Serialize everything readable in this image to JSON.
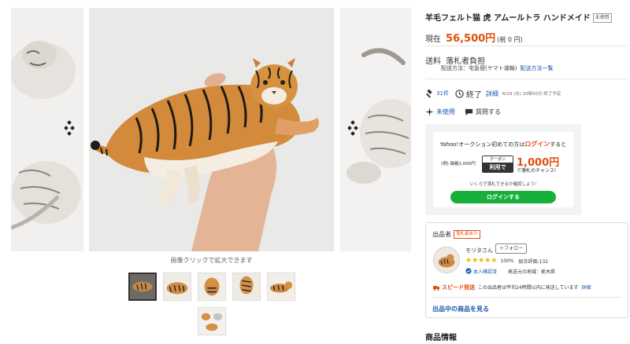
{
  "product": {
    "title": "羊毛フェルト猫 虎 アムールトラ ハンドメイド",
    "condition_badge": "未使用"
  },
  "gallery": {
    "zoom_caption": "画像クリックで拡大できます",
    "thumbnail_count": 6,
    "active_thumbnail": 1
  },
  "price": {
    "label": "現在",
    "value": "56,500円",
    "tax": "(税 0 円)"
  },
  "shipping": {
    "label": "送料",
    "value": "落札者負担",
    "method": "配送方法：宅急便(ヤマト運輸)",
    "method_link": "配送方法一覧"
  },
  "auction": {
    "bid_count": "31件",
    "end_label": "終了",
    "detail_link": "詳細",
    "end_date": "6/19 (水) 20時50分 終了予定"
  },
  "item_meta": {
    "condition": "未使用",
    "purchase": "質問する"
  },
  "banner": {
    "line1_prefix": "Yahoo!オークション初めての方は",
    "line1_login": "ログイン",
    "line1_suffix": "すると",
    "small_text": "(例) 価格2,000円",
    "coupon_top": "クーポン",
    "coupon_bottom": "利用で",
    "amount": "1,000円",
    "chance": "で落札のチャンス!",
    "line3": "いくらで落札できるか確認しよう!",
    "button": "ログインする"
  },
  "seller": {
    "heading": "出品者",
    "badge": "落札者あり",
    "name": "モリタさん",
    "follow": "＋フォロー",
    "rating_pct": "100%",
    "rating_total": "総合評価:132",
    "auth": "本人確認済",
    "origin": "発送元の地域：栃木県",
    "speed_label": "スピード発送",
    "speed_text": "この出品者は平均24時間以内に発送しています",
    "speed_detail": "詳細",
    "items_link": "出品中の商品を見る"
  },
  "section": {
    "title": "商品情報"
  },
  "colors": {
    "accent_orange": "#e0500f",
    "link_blue": "#1a57b0",
    "login_green": "#17b03a"
  }
}
